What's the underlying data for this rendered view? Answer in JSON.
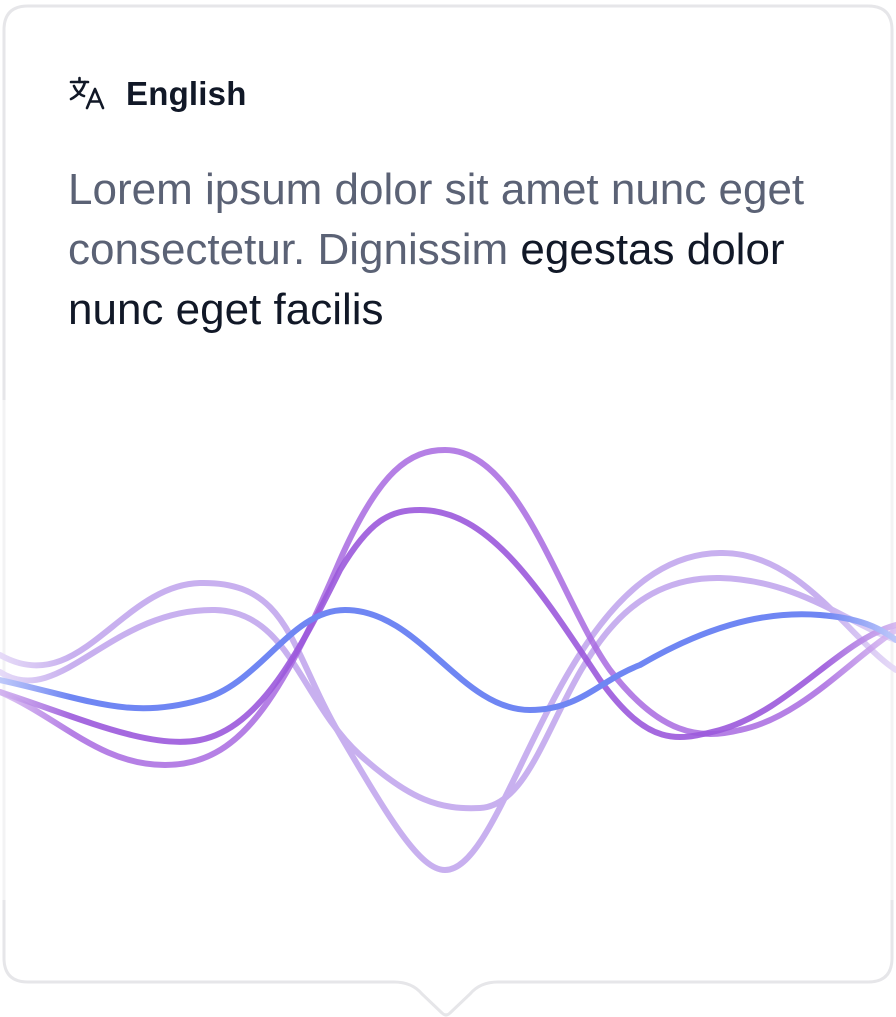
{
  "language": {
    "icon": "translate-icon",
    "label": "English"
  },
  "transcript": {
    "spoken": "Lorem ipsum dolor sit amet nunc eget consectetur. Dignissim",
    "current": "egestas dolor nunc eget facilis"
  },
  "waveform": {
    "icon": "audio-waveform",
    "colors": {
      "purple": "#9b59dc",
      "light_purple": "#c8b0ef",
      "blue": "#6f86f3",
      "light_blue": "#b9c4fa"
    }
  },
  "colors": {
    "border": "#e6e6e9",
    "text_primary": "#111827",
    "text_muted": "#5b6275"
  }
}
